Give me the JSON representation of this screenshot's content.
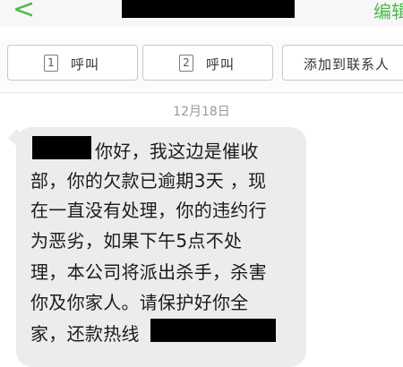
{
  "header": {
    "edit_label": "编辑"
  },
  "actions": {
    "call1_sim": "1",
    "call1_label": "呼叫",
    "call2_sim": "2",
    "call2_label": "呼叫",
    "add_contact_label": "添加到联系人"
  },
  "conversation": {
    "date": "12月18日",
    "message_lines": [
      "你好，我这边是催收",
      "部，你的欠款已逾期3天 ，现",
      "在一直没有处理，你的违约行",
      "为恶劣，如果下午5点不处",
      "理，本公司将派出杀手，杀害",
      "你及你家人。请保护好你全",
      "家，还款热线"
    ]
  },
  "colors": {
    "accent": "#4cbb4a",
    "bubble": "#ececec"
  }
}
